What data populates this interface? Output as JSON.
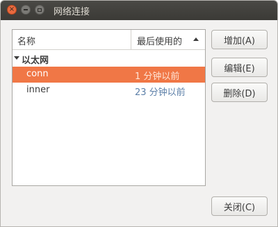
{
  "window": {
    "title": "网络连接",
    "close_glyph": "×",
    "colors": {
      "titlebar": "#3c3b37",
      "accent": "#f07746",
      "background": "#f2f1f0"
    }
  },
  "list": {
    "columns": {
      "name": "名称",
      "last_used": "最后使用的"
    },
    "group": {
      "label": "以太网"
    },
    "rows": [
      {
        "name": "conn",
        "last_used": "1 分钟以前",
        "selected": true
      },
      {
        "name": "inner",
        "last_used": "23 分钟以前",
        "selected": false
      }
    ]
  },
  "buttons": {
    "add": "增加(A)",
    "edit": "编辑(E)",
    "delete": "删除(D)",
    "close": "关闭(C)"
  }
}
